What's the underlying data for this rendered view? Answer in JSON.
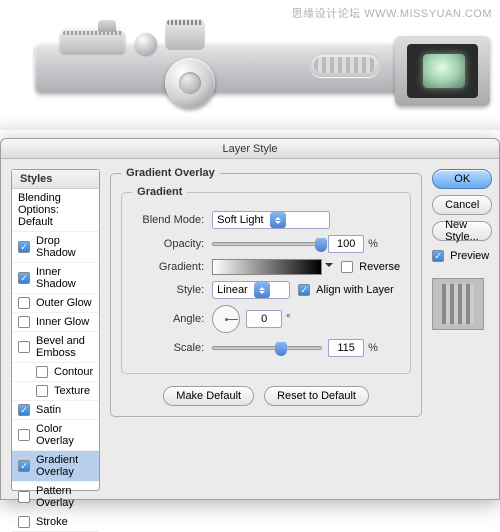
{
  "watermark": "思缘设计论坛  WWW.MISSYUAN.COM",
  "dialog": {
    "title": "Layer Style",
    "sidebar": {
      "header": "Styles",
      "blending": "Blending Options: Default",
      "items": [
        {
          "label": "Drop Shadow",
          "checked": true,
          "selected": false
        },
        {
          "label": "Inner Shadow",
          "checked": true,
          "selected": false
        },
        {
          "label": "Outer Glow",
          "checked": false,
          "selected": false
        },
        {
          "label": "Inner Glow",
          "checked": false,
          "selected": false
        },
        {
          "label": "Bevel and Emboss",
          "checked": false,
          "selected": false
        },
        {
          "label": "Contour",
          "checked": false,
          "selected": false,
          "indent": true
        },
        {
          "label": "Texture",
          "checked": false,
          "selected": false,
          "indent": true
        },
        {
          "label": "Satin",
          "checked": true,
          "selected": false
        },
        {
          "label": "Color Overlay",
          "checked": false,
          "selected": false
        },
        {
          "label": "Gradient Overlay",
          "checked": true,
          "selected": true
        },
        {
          "label": "Pattern Overlay",
          "checked": false,
          "selected": false
        },
        {
          "label": "Stroke",
          "checked": false,
          "selected": false
        }
      ]
    },
    "group": {
      "title": "Gradient Overlay",
      "subtitle": "Gradient",
      "blend_mode": {
        "label": "Blend Mode:",
        "value": "Soft Light"
      },
      "opacity": {
        "label": "Opacity:",
        "value": "100",
        "unit": "%",
        "pos": 100
      },
      "gradient": {
        "label": "Gradient:",
        "reverse_label": "Reverse",
        "reverse": false
      },
      "style": {
        "label": "Style:",
        "value": "Linear",
        "align_label": "Align with Layer",
        "align": true
      },
      "angle": {
        "label": "Angle:",
        "value": "0",
        "unit": "°"
      },
      "scale": {
        "label": "Scale:",
        "value": "115",
        "unit": "%",
        "pos": 63
      },
      "buttons": {
        "default": "Make Default",
        "reset": "Reset to Default"
      }
    },
    "right": {
      "ok": "OK",
      "cancel": "Cancel",
      "newstyle": "New Style...",
      "preview_label": "Preview",
      "preview": true
    }
  }
}
